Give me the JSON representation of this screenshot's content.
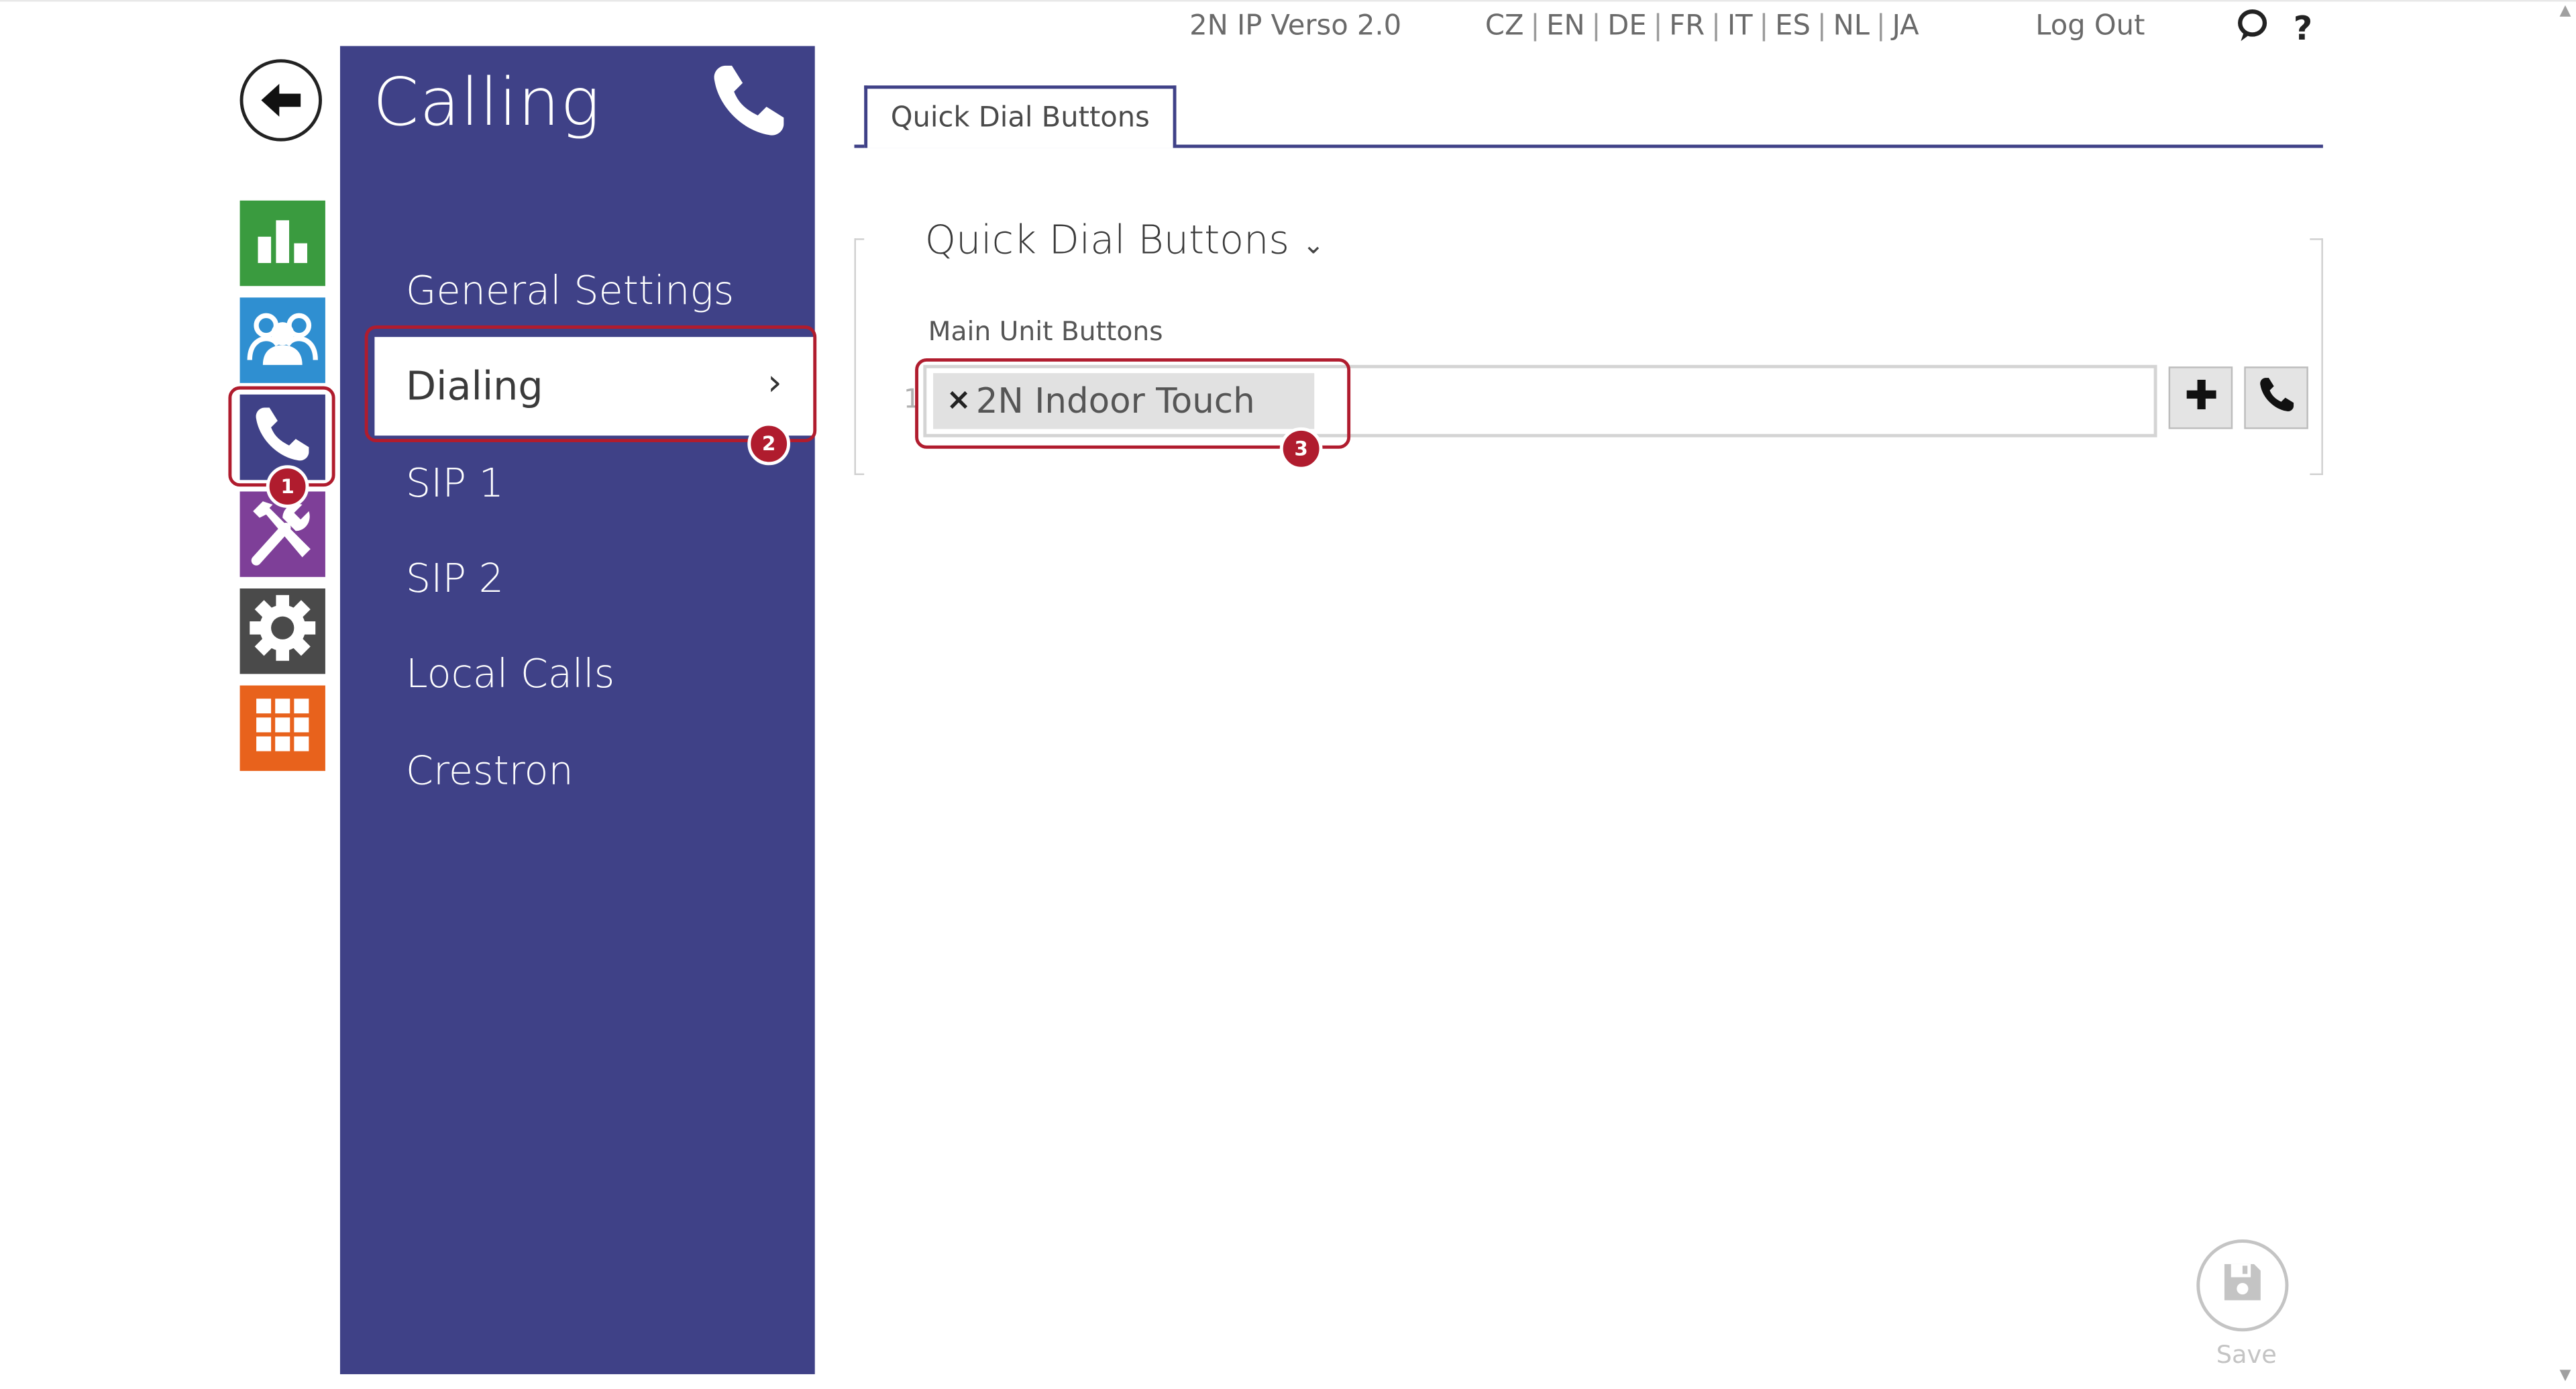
{
  "header": {
    "product": "2N IP Verso 2.0",
    "languages": [
      "CZ",
      "EN",
      "DE",
      "FR",
      "IT",
      "ES",
      "NL",
      "JA"
    ],
    "logout": "Log Out",
    "help_label": "?"
  },
  "sidebar": {
    "title": "Calling",
    "items": [
      {
        "label": "General Settings"
      },
      {
        "label": "Dialing"
      },
      {
        "label": "SIP 1"
      },
      {
        "label": "SIP 2"
      },
      {
        "label": "Local Calls"
      },
      {
        "label": "Crestron"
      }
    ],
    "active_chevron": "›"
  },
  "tabs": [
    {
      "label": "Quick Dial Buttons"
    }
  ],
  "section": {
    "title": "Quick Dial Buttons",
    "chevron": "⌄",
    "field_label": "Main Unit Buttons",
    "row_index": "1",
    "tag_remove": "×",
    "tag_value": "2N Indoor Touch"
  },
  "badges": [
    "1",
    "2",
    "3"
  ],
  "save_label": "Save",
  "colors": {
    "brand_sidebar": "#3f4187",
    "highlight": "#b01c2e",
    "status_green": "#3a9b3f",
    "directory_blue": "#2f8fd1",
    "services_purple": "#7e3f98",
    "system_gray": "#4a4a4a",
    "apps_orange": "#e8621c"
  },
  "icons": {
    "back": "arrow-left-icon",
    "status": "bar-chart-icon",
    "directory": "users-icon",
    "calling": "phone-icon",
    "services": "tools-icon",
    "system": "gear-icon",
    "apps": "grid-icon",
    "add": "plus-icon",
    "call": "phone-icon",
    "save": "floppy-disk-icon",
    "help": "question-icon",
    "chat": "speech-bubble-icon"
  }
}
